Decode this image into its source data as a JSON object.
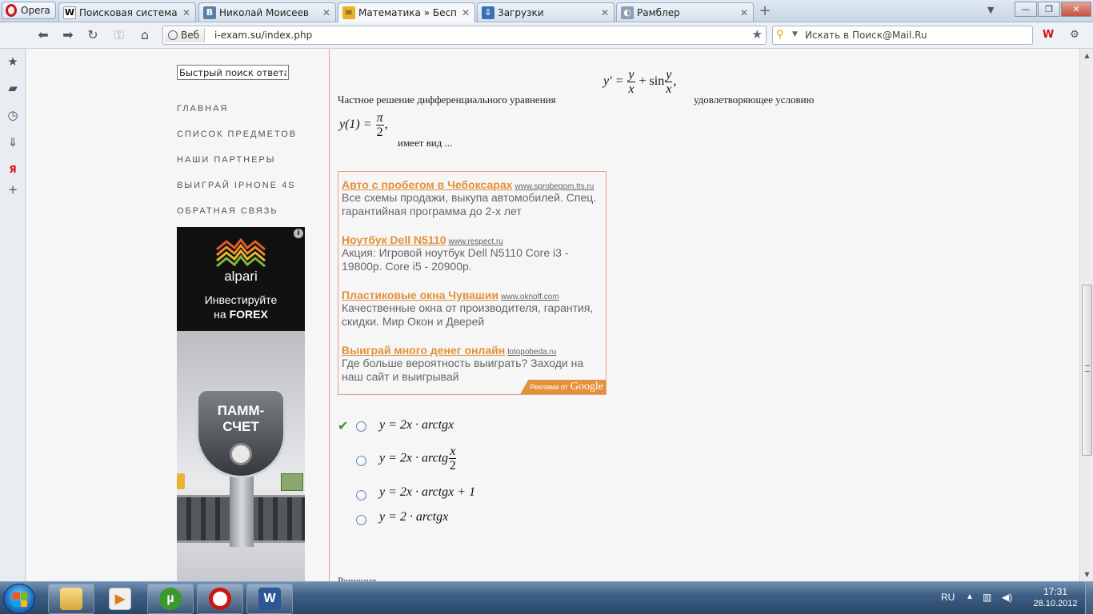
{
  "browser": {
    "menu_label": "Opera",
    "tabs": [
      {
        "label": "Поисковая система W...",
        "fav": "W",
        "fav_color": "#ffffff"
      },
      {
        "label": "Николай Моисеев",
        "fav": "B",
        "fav_color": "#5b7fa6"
      },
      {
        "label": "Математика » Бесплат...",
        "fav": "✉",
        "fav_color": "#e8b220"
      },
      {
        "label": "Загрузки",
        "fav": "⇩",
        "fav_color": "#3b6fb5"
      },
      {
        "label": "Рамблер",
        "fav": "◐",
        "fav_color": "#8aa0b8"
      }
    ],
    "web_badge": "Веб",
    "url": "i-exam.su/index.php",
    "search_placeholder": "Искать в Поиск@Mail.Ru"
  },
  "sidebar": {
    "quick_search_value": "Быстрый поиск ответа...",
    "menu": [
      "ГЛАВНАЯ",
      "СПИСОК ПРЕДМЕТОВ",
      "НАШИ ПАРТНЕРЫ",
      "ВЫИГРАЙ IPHONE 4S",
      "ОБРАТНАЯ СВЯЗЬ"
    ],
    "banner": {
      "brand": "alpari",
      "line1": "Инвестируйте",
      "line2_prefix": "на ",
      "line2_bold": "FOREX",
      "badge_line1": "ПАММ-",
      "badge_line2": "СЧЕТ"
    }
  },
  "question": {
    "text_before": "Частное решение дифференциального уравнения",
    "text_middle": "удовлетворяющее условию",
    "text_after": "имеет вид ...",
    "equation": {
      "lhs": "y′ = ",
      "frac1_num": "y",
      "frac1_den": "x",
      "plus": " + sin",
      "frac2_num": "y",
      "frac2_den": "x",
      "comma": ","
    },
    "condition": {
      "lhs": "y(1) = ",
      "num": "π",
      "den": "2",
      "comma": ","
    }
  },
  "ads": [
    {
      "title": "Авто с пробегом в Чебоксарах",
      "url": "www.sprobegom.tts.ru",
      "text": "Все схемы продажи, выкупа автомобилей. Спец. гарантийная программа до 2-х лет"
    },
    {
      "title": "Ноутбук Dell N5110",
      "url": "www.respect.ru",
      "text": "Акция: Игровой ноутбук Dell N5110 Core i3 - 19800р. Core i5 - 20900р."
    },
    {
      "title": "Пластиковые окна Чувашии",
      "url": "www.oknoff.com",
      "text": "Качественные окна от производителя, гарантия, скидки. Мир Окон и Дверей"
    },
    {
      "title": "Выиграй много денег онлайн",
      "url": "lotopobeda.ru",
      "text": "Где больше вероятность выиграть? Заходи на наш сайт и выигрывай"
    }
  ],
  "ads_badge": {
    "prefix": "Реклама от",
    "brand": "Google"
  },
  "answers": [
    {
      "expr": "y = 2x · arctgx",
      "checked": true
    },
    {
      "expr_prefix": "y = 2x · arctg",
      "frac_num": "x",
      "frac_den": "2",
      "checked": false
    },
    {
      "expr": "y = 2x · arctgx + 1",
      "checked": false
    },
    {
      "expr": "y = 2 · arctgx",
      "checked": false
    }
  ],
  "solution_label": "Решение",
  "taskbar": {
    "lang": "RU",
    "time": "17:31",
    "date": "28.10.2012"
  },
  "colors": {
    "accent_orange": "#e3913a",
    "divider": "#e0a38a",
    "check_green": "#2e9a1d",
    "opera_red": "#cc1616"
  }
}
